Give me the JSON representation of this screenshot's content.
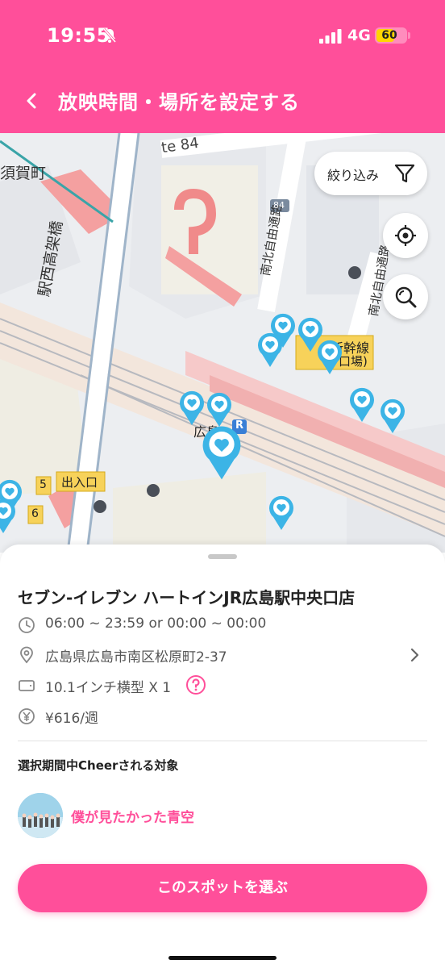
{
  "status_bar": {
    "time": "19:55",
    "network": "4G",
    "battery": "60",
    "battery_level": 0.6
  },
  "header": {
    "title": "放映時間・場所を設定する"
  },
  "map": {
    "labels": {
      "road_route": "te 84",
      "road_84": "84",
      "district": "須賀町",
      "bridge": "駅西高架橋",
      "nanboku1": "南北自由通路",
      "nanboku2": "南北自由通路",
      "shinkansen": "新幹線",
      "shinkansen_sub": "口場)",
      "station": "広島",
      "station_mark": "R",
      "exit": "出入口",
      "exit5": "5",
      "exit6": "6"
    },
    "filter_label": "絞り込み"
  },
  "spot": {
    "name": "セブン-イレブン ハートインJR広島駅中央口店",
    "hours": "06:00 ~ 23:59 or 00:00 ~ 00:00",
    "address": "広島県広島市南区松原町2-37",
    "screen": "10.1インチ横型 X 1",
    "price": "¥616/週"
  },
  "cheer": {
    "section_title": "選択期間中Cheerされる対象",
    "target_name": "僕が見たかった青空"
  },
  "action": {
    "select_label": "このスポットを選ぶ"
  },
  "colors": {
    "brand": "#ff4f9a",
    "pin": "#3cb4e6"
  },
  "icons": [
    "back-icon",
    "filter-icon",
    "location-target-icon",
    "search-zoom-icon",
    "clock-icon",
    "location-pin-icon",
    "screen-icon",
    "help-icon",
    "yen-icon",
    "chevron-right-icon",
    "heart-pin-icon"
  ]
}
